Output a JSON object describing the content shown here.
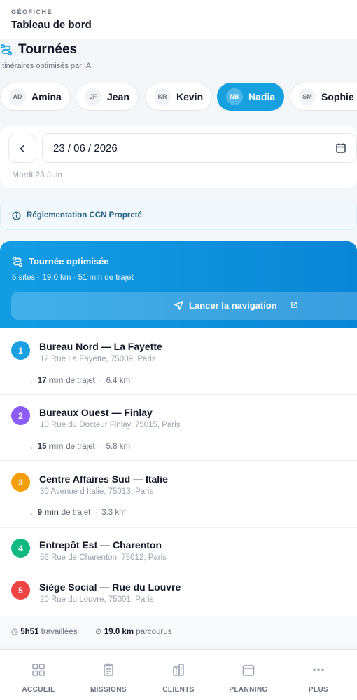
{
  "header": {
    "brand": "GÉOFICHE",
    "page_title": "Tableau de bord"
  },
  "section": {
    "title": "Tournées",
    "subtitle": "Itinéraires optimisés par IA"
  },
  "agents": [
    {
      "initials": "AD",
      "name": "Amina",
      "active": false
    },
    {
      "initials": "JF",
      "name": "Jean",
      "active": false
    },
    {
      "initials": "KR",
      "name": "Kevin",
      "active": false
    },
    {
      "initials": "NB",
      "name": "Nadia",
      "active": true
    },
    {
      "initials": "SM",
      "name": "Sophie",
      "active": false
    }
  ],
  "date": {
    "value": "23 / 06 / 2026",
    "day_label": "Mardi 23 Juin"
  },
  "regulation": {
    "label": "Réglementation CCN Propreté"
  },
  "route": {
    "title": "Tournée optimisée",
    "stats": "5 sites · 19.0 km · 51 min de trajet",
    "nav_button": "Lancer la navigation"
  },
  "stops": [
    {
      "number": "1",
      "name": "Bureau Nord — La Fayette",
      "address": "12 Rue La Fayette, 75009, Paris",
      "color": "#1a9fe0"
    },
    {
      "number": "2",
      "name": "Bureaux Ouest — Finlay",
      "address": "10 Rue du Docteur Finlay, 75015, Paris",
      "color": "#8b5cf6"
    },
    {
      "number": "3",
      "name": "Centre Affaires Sud — Italie",
      "address": "30 Avenue d Italie, 75013, Paris",
      "color": "#f59e0b"
    },
    {
      "number": "4",
      "name": "Entrepôt Est — Charenton",
      "address": "56 Rue de Charenton, 75012, Paris",
      "color": "#10b981"
    },
    {
      "number": "5",
      "name": "Siège Social — Rue du Louvre",
      "address": "20 Rue du Louvre, 75001, Paris",
      "color": "#ef4444"
    }
  ],
  "legs": [
    {
      "duration": "17 min",
      "label": "de trajet",
      "distance": "6.4 km"
    },
    {
      "duration": "15 min",
      "label": "de trajet",
      "distance": "5.8 km"
    },
    {
      "duration": "9 min",
      "label": "de trajet",
      "distance": "3.3 km"
    }
  ],
  "summary": {
    "worked_value": "5h51",
    "worked_label": "travaillées",
    "distance_value": "19.0 km",
    "distance_label": "parcourus"
  },
  "bottom_nav": [
    {
      "label": "ACCUEIL",
      "icon": "grid-icon"
    },
    {
      "label": "MISSIONS",
      "icon": "clipboard-icon"
    },
    {
      "label": "CLIENTS",
      "icon": "building-icon"
    },
    {
      "label": "PLANNING",
      "icon": "calendar-icon"
    },
    {
      "label": "PLUS",
      "icon": "more-icon"
    }
  ],
  "colors": {
    "accent": "#16a0e0",
    "accent_dark": "#0a86d6"
  }
}
